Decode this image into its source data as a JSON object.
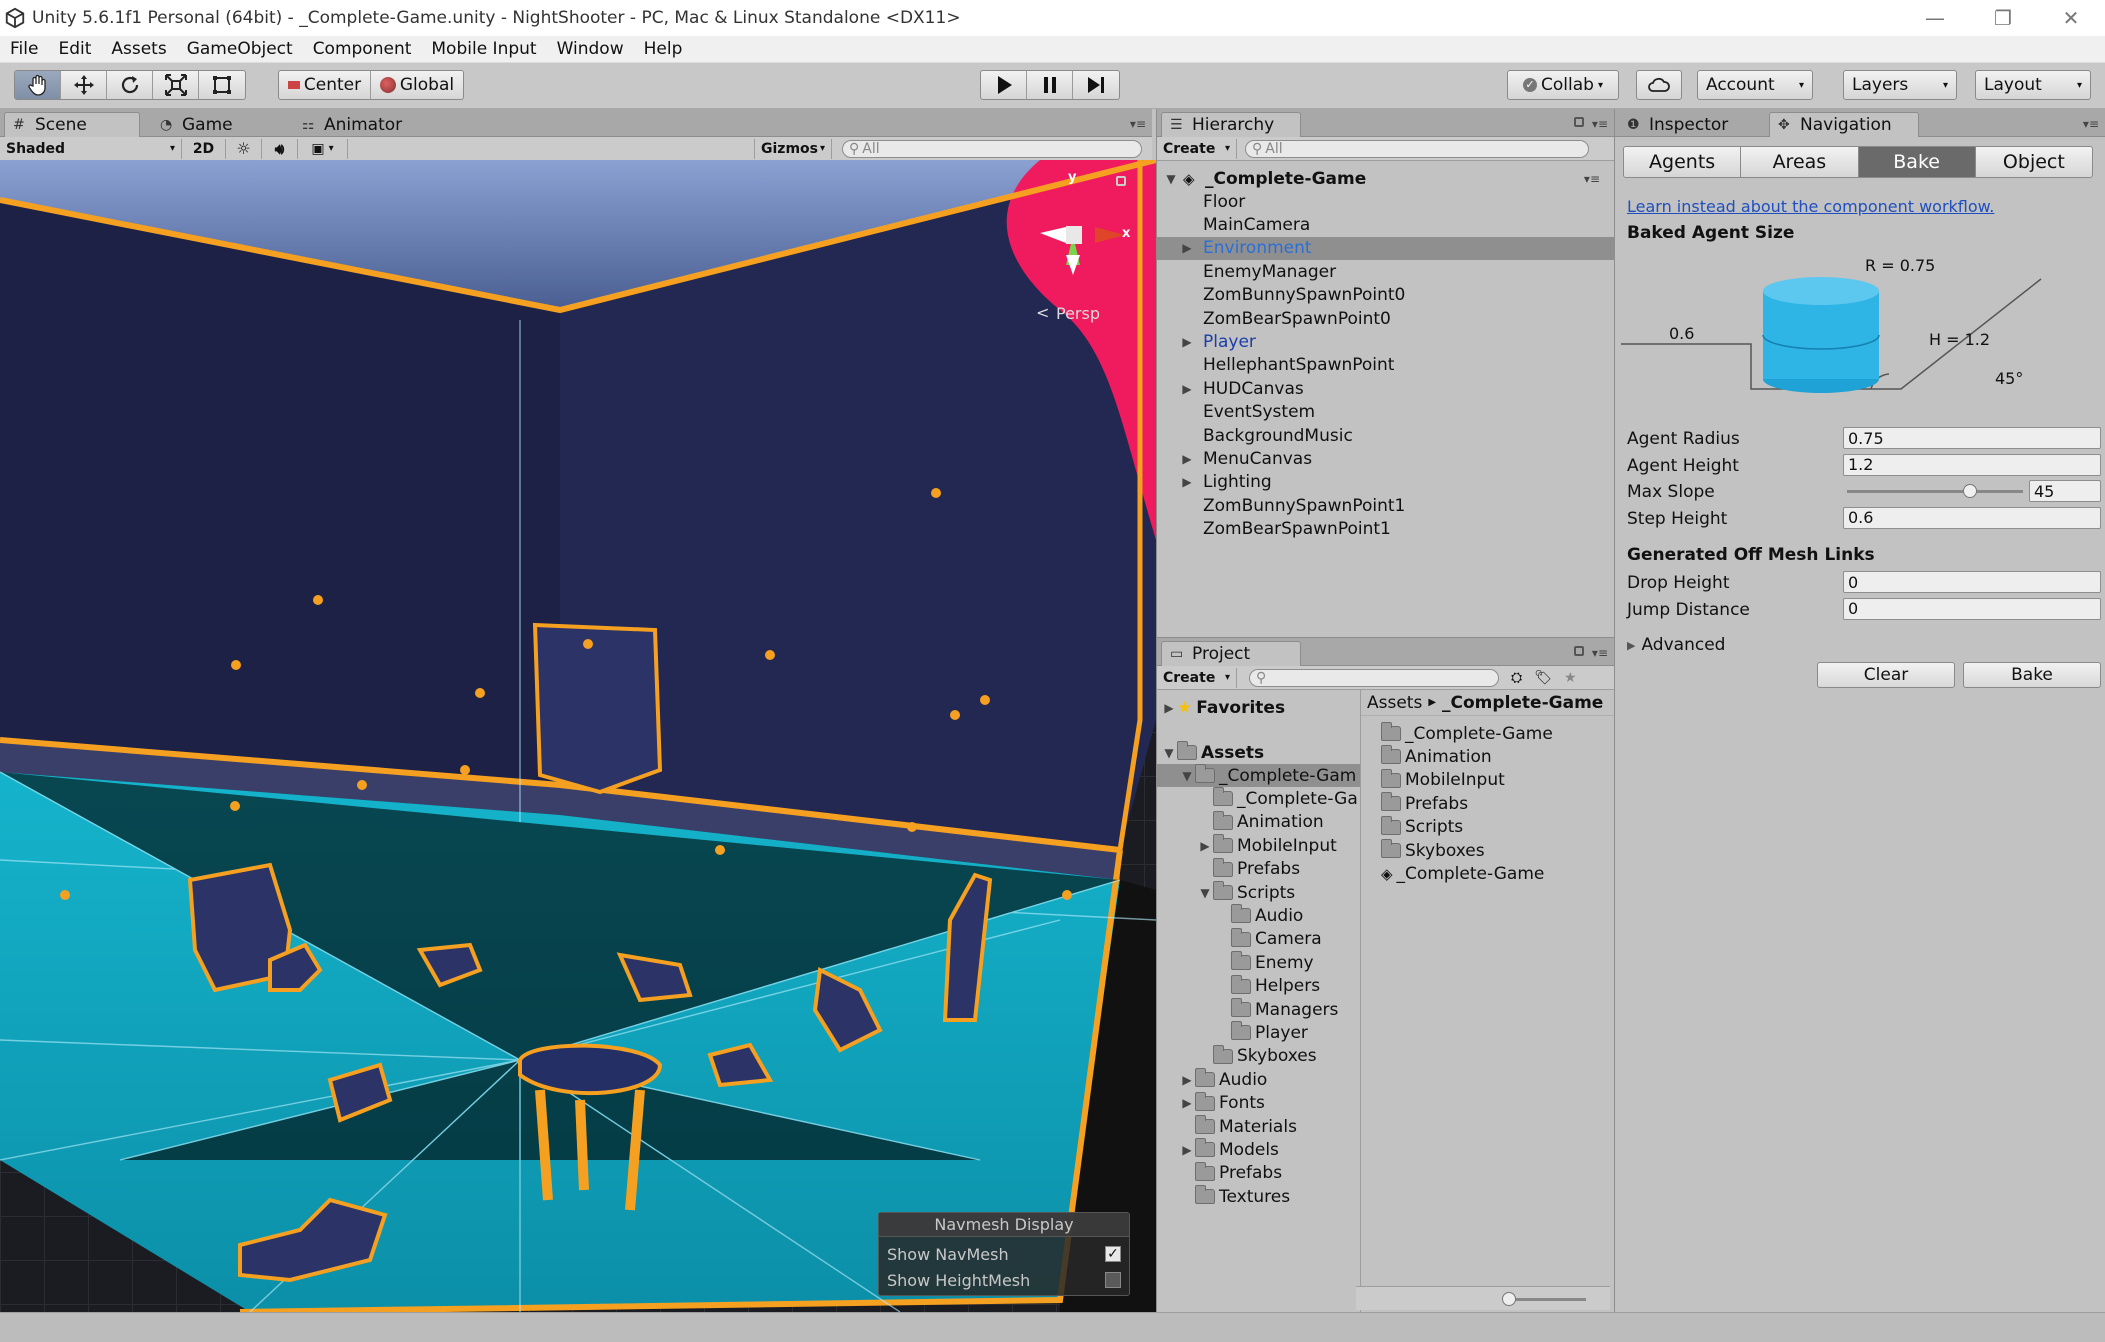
{
  "window": {
    "title": "Unity 5.6.1f1 Personal (64bit) - _Complete-Game.unity - NightShooter - PC, Mac & Linux Standalone <DX11>",
    "minimize": "—",
    "restore": "❐",
    "close": "✕"
  },
  "menu": [
    "File",
    "Edit",
    "Assets",
    "GameObject",
    "Component",
    "Mobile Input",
    "Window",
    "Help"
  ],
  "toolbar": {
    "center_label": "Center",
    "global_label": "Global",
    "collab_label": "Collab",
    "account_label": "Account",
    "layers_label": "Layers",
    "layout_label": "Layout"
  },
  "scene": {
    "tabs": [
      "Scene",
      "Game",
      "Animator"
    ],
    "shading_mode": "Shaded",
    "mode_2d": "2D",
    "gizmos_label": "Gizmos",
    "search_placeholder": "All",
    "gizmo_persp": "Persp",
    "gizmo_axis_y": "y",
    "gizmo_axis_x": "x",
    "navmesh_display": {
      "title": "Navmesh Display",
      "show_navmesh": "Show NavMesh",
      "show_navmesh_checked": true,
      "show_heightmesh": "Show HeightMesh",
      "show_heightmesh_checked": false
    }
  },
  "hierarchy": {
    "tab": "Hierarchy",
    "create_label": "Create",
    "search_placeholder": "All",
    "scene_name": "_Complete-Game",
    "items": [
      {
        "label": "Floor",
        "expandable": false,
        "style": "normal"
      },
      {
        "label": "MainCamera",
        "expandable": false,
        "style": "normal"
      },
      {
        "label": "Environment",
        "expandable": true,
        "style": "selected"
      },
      {
        "label": "EnemyManager",
        "expandable": false,
        "style": "normal"
      },
      {
        "label": "ZomBunnySpawnPoint0",
        "expandable": false,
        "style": "normal"
      },
      {
        "label": "ZomBearSpawnPoint0",
        "expandable": false,
        "style": "normal"
      },
      {
        "label": "Player",
        "expandable": true,
        "style": "prefab"
      },
      {
        "label": "HellephantSpawnPoint",
        "expandable": false,
        "style": "normal"
      },
      {
        "label": "HUDCanvas",
        "expandable": true,
        "style": "normal"
      },
      {
        "label": "EventSystem",
        "expandable": false,
        "style": "normal"
      },
      {
        "label": "BackgroundMusic",
        "expandable": false,
        "style": "normal"
      },
      {
        "label": "MenuCanvas",
        "expandable": true,
        "style": "normal"
      },
      {
        "label": "Lighting",
        "expandable": true,
        "style": "normal"
      },
      {
        "label": "ZomBunnySpawnPoint1",
        "expandable": false,
        "style": "normal"
      },
      {
        "label": "ZomBearSpawnPoint1",
        "expandable": false,
        "style": "normal"
      }
    ]
  },
  "project": {
    "tab": "Project",
    "create_label": "Create",
    "favorites_label": "Favorites",
    "assets_label": "Assets",
    "breadcrumb": [
      "Assets",
      "_Complete-Game"
    ],
    "tree": [
      {
        "label": "_Complete-Gam",
        "indent": 1,
        "arrow": "down",
        "selected": true
      },
      {
        "label": "_Complete-Ga",
        "indent": 2,
        "arrow": "none"
      },
      {
        "label": "Animation",
        "indent": 2,
        "arrow": "none"
      },
      {
        "label": "MobileInput",
        "indent": 2,
        "arrow": "right"
      },
      {
        "label": "Prefabs",
        "indent": 2,
        "arrow": "none"
      },
      {
        "label": "Scripts",
        "indent": 2,
        "arrow": "down"
      },
      {
        "label": "Audio",
        "indent": 3,
        "arrow": "none"
      },
      {
        "label": "Camera",
        "indent": 3,
        "arrow": "none"
      },
      {
        "label": "Enemy",
        "indent": 3,
        "arrow": "none"
      },
      {
        "label": "Helpers",
        "indent": 3,
        "arrow": "none"
      },
      {
        "label": "Managers",
        "indent": 3,
        "arrow": "none"
      },
      {
        "label": "Player",
        "indent": 3,
        "arrow": "none"
      },
      {
        "label": "Skyboxes",
        "indent": 2,
        "arrow": "none"
      },
      {
        "label": "Audio",
        "indent": 1,
        "arrow": "right"
      },
      {
        "label": "Fonts",
        "indent": 1,
        "arrow": "right"
      },
      {
        "label": "Materials",
        "indent": 1,
        "arrow": "none"
      },
      {
        "label": "Models",
        "indent": 1,
        "arrow": "right"
      },
      {
        "label": "Prefabs",
        "indent": 1,
        "arrow": "none"
      },
      {
        "label": "Textures",
        "indent": 1,
        "arrow": "none"
      }
    ],
    "contents": [
      "_Complete-Game",
      "Animation",
      "MobileInput",
      "Prefabs",
      "Scripts",
      "Skyboxes",
      "_Complete-Game"
    ]
  },
  "inspector": {
    "tabs": [
      "Inspector",
      "Navigation"
    ],
    "nav_tabs": [
      "Agents",
      "Areas",
      "Bake",
      "Object"
    ],
    "active_nav_tab": "Bake",
    "link_text": "Learn instead about the component workflow.",
    "baked_agent_size": "Baked Agent Size",
    "diagram": {
      "radius": "R = 0.75",
      "height": "H = 1.2",
      "step": "0.6",
      "slope": "45°"
    },
    "fields": [
      {
        "label": "Agent Radius",
        "value": "0.75"
      },
      {
        "label": "Agent Height",
        "value": "1.2"
      },
      {
        "label": "Max Slope",
        "value": "45",
        "slider": true,
        "fraction": 0.7
      },
      {
        "label": "Step Height",
        "value": "0.6"
      }
    ],
    "offmesh_header": "Generated Off Mesh Links",
    "offmesh_fields": [
      {
        "label": "Drop Height",
        "value": "0"
      },
      {
        "label": "Jump Distance",
        "value": "0"
      }
    ],
    "advanced_label": "Advanced",
    "clear_label": "Clear",
    "bake_label": "Bake"
  }
}
